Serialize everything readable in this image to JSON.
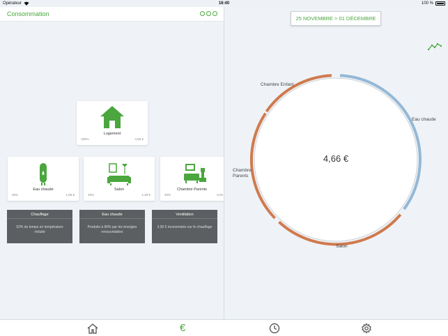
{
  "status_bar": {
    "carrier": "Opérateur",
    "time": "16:40",
    "battery": "100 %"
  },
  "left": {
    "title": "Consommation",
    "cards": {
      "logement": {
        "label": "Logement",
        "pct": "100%",
        "value": "4,66 €"
      },
      "eau_chaude": {
        "label": "Eau chaude",
        "pct": "35%",
        "value": "1,65 €"
      },
      "salon": {
        "label": "Salon",
        "pct": "28%",
        "value": "1,29 €"
      },
      "chambre_parents": {
        "label": "Chambre Parents",
        "pct": "20%",
        "value": "0,94"
      }
    },
    "info_tiles": [
      {
        "title": "Chauffage",
        "text": "52% du temps en température réduite"
      },
      {
        "title": "Eau chaude",
        "text": "Produits à 90% par les énergies renouvelables"
      },
      {
        "title": "Ventilation",
        "text": "3,00 € économisés sur le chauffage"
      }
    ]
  },
  "right": {
    "date_range": "25 NOVEMBRE > 01 DÉCEMBRE",
    "total": "4,66 €",
    "segments": [
      {
        "name": "Eau chaude",
        "color": "#94b8d6"
      },
      {
        "name": "Salon",
        "color": "#d07a4e"
      },
      {
        "name": "Chambre Parents",
        "color": "#d07a4e"
      },
      {
        "name": "Chambre Enfant",
        "color": "#d07a4e"
      }
    ],
    "segment_labels": {
      "chambre_enfant": "Chambre Enfant",
      "eau_chaude": "Eau chaude",
      "chambre_parents_1": "Chambre",
      "chambre_parents_2": "Parents",
      "salon": "Salon"
    }
  },
  "tabbar": {
    "items": [
      "home-icon",
      "euro-icon",
      "clock-icon",
      "gear-icon"
    ],
    "active": "euro-icon",
    "euro_glyph": "€"
  },
  "colors": {
    "accent": "#4aa63d",
    "tile": "#5c5f62"
  }
}
